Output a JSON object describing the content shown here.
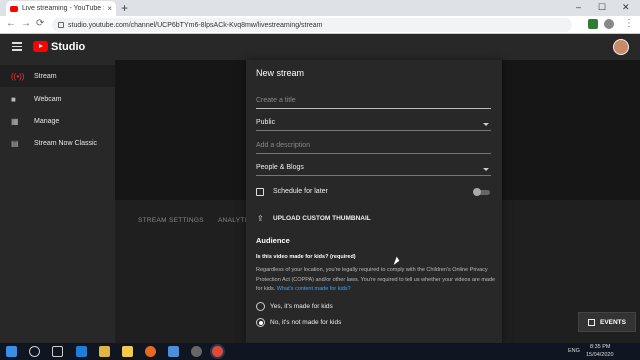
{
  "browser": {
    "tab_title": "Live streaming - YouTube Studio",
    "tab_close": "×",
    "new_tab": "+",
    "url": "studio.youtube.com/channel/UCP6bTYm6-8lpsACk-Kvq8mw/livestreaming/stream",
    "minimize": "–",
    "maximize": "☐",
    "close": "✕",
    "back": "←",
    "forward": "→",
    "reload": "⟳"
  },
  "studio": {
    "logo_text": "Studio"
  },
  "sidebar": {
    "items": [
      {
        "label": "Stream",
        "icon": "broadcast-icon"
      },
      {
        "label": "Webcam",
        "icon": "camera-icon"
      },
      {
        "label": "Manage",
        "icon": "calendar-icon"
      },
      {
        "label": "Stream Now Classic",
        "icon": "document-icon"
      }
    ]
  },
  "main": {
    "tab_stream_settings": "STREAM SETTINGS",
    "tab_analytics": "ANALYTI"
  },
  "modal": {
    "title": "New stream",
    "title_placeholder": "Create a title",
    "visibility": "Public",
    "description_placeholder": "Add a description",
    "category": "People & Blogs",
    "schedule_label": "Schedule for later",
    "schedule_enabled": false,
    "upload_label": "UPLOAD CUSTOM THUMBNAIL",
    "audience_heading": "Audience",
    "kids_question": "Is this video made for kids? (required)",
    "legal_text": "Regardless of your location, you're legally required to comply with the Children's Online Privacy Protection Act (COPPA) and/or other laws. You're required to tell us whether your videos are made for kids.",
    "legal_link": "What's content made for kids?",
    "option_yes": "Yes, it's made for kids",
    "option_no": "No, it's not made for kids",
    "selected_option": "No, it's not made for kids"
  },
  "events_button": "EVENTS",
  "taskbar": {
    "lang": "ENG",
    "time": "8:35 PM",
    "date": "15/04/2020"
  },
  "colors": {
    "brand_red": "#ff0000",
    "link_blue": "#3ea6ff",
    "panel": "#282828",
    "background": "#1f1f1f"
  }
}
